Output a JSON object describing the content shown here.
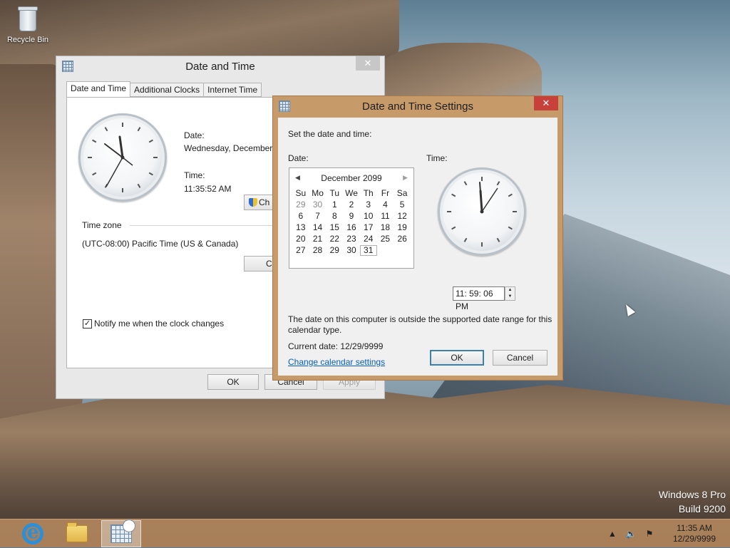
{
  "desktop": {
    "icons": [
      {
        "label": "Recycle Bin",
        "icon": "recycle-bin-icon"
      }
    ],
    "watermark": {
      "line1": "Windows 8 Pro",
      "line2": "Build 9200"
    }
  },
  "date_time_window": {
    "title": "Date and Time",
    "tabs": [
      "Date and Time",
      "Additional Clocks",
      "Internet Time"
    ],
    "date_label": "Date:",
    "date_value": "Wednesday, December",
    "time_label": "Time:",
    "time_value": "11:35:52 AM",
    "change_button": "Ch",
    "time_zone_label": "Time zone",
    "time_zone_value": "(UTC-08:00) Pacific Time (US & Canada)",
    "change_tz_button": "Cl",
    "notify_checkbox": {
      "label": "Notify me when the clock changes",
      "checked": true
    },
    "buttons": {
      "ok": "OK",
      "cancel": "Cancel",
      "apply": "Apply"
    }
  },
  "settings_dialog": {
    "title": "Date and Time Settings",
    "instruction": "Set the date and time:",
    "date_label": "Date:",
    "time_label": "Time:",
    "calendar": {
      "month_title": "December 2099",
      "weekdays": [
        "Su",
        "Mo",
        "Tu",
        "We",
        "Th",
        "Fr",
        "Sa"
      ],
      "weeks": [
        [
          "29",
          "30",
          "1",
          "2",
          "3",
          "4",
          "5"
        ],
        [
          "6",
          "7",
          "8",
          "9",
          "10",
          "11",
          "12"
        ],
        [
          "13",
          "14",
          "15",
          "16",
          "17",
          "18",
          "19"
        ],
        [
          "20",
          "21",
          "22",
          "23",
          "24",
          "25",
          "26"
        ],
        [
          "27",
          "28",
          "29",
          "30",
          "31",
          "",
          ""
        ]
      ],
      "other_month_days": [
        "29",
        "30"
      ],
      "selected_day": "31"
    },
    "time_value": "11: 59: 06 PM",
    "message_line1": "The date on this computer is outside the supported date range for this",
    "message_line2": "calendar type.",
    "current_date_label": "Current date: 12/29/9999",
    "change_calendar_link": "Change calendar settings",
    "buttons": {
      "ok": "OK",
      "cancel": "Cancel"
    },
    "accent_color": "#c79a6a",
    "close_color": "#c7403a"
  },
  "taskbar": {
    "apps": [
      "internet-explorer-icon",
      "file-explorer-icon",
      "date-time-settings-icon"
    ],
    "clock_time": "11:35 AM",
    "clock_date": "12/29/9999",
    "color": "#b08258"
  }
}
